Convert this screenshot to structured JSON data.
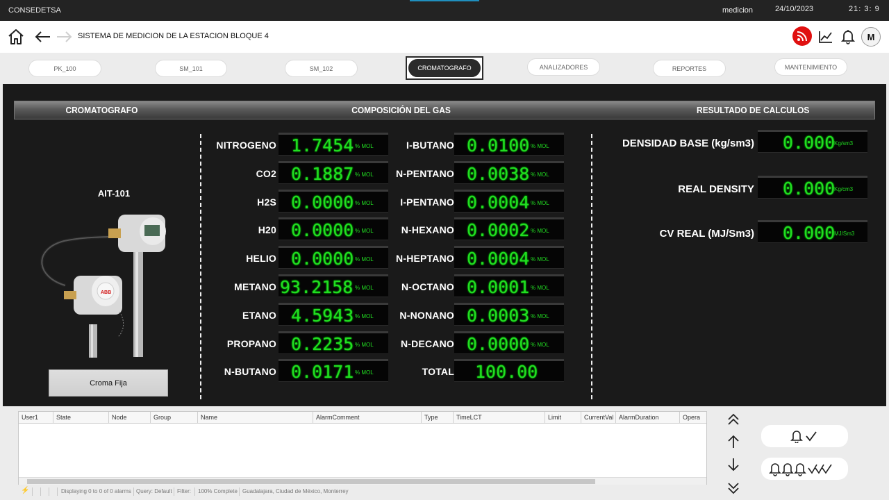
{
  "topbar": {
    "app": "CONSEDETSA",
    "user": "medicion",
    "date": "24/10/2023",
    "time": "21:  3:  9"
  },
  "header": {
    "title": "SISTEMA DE MEDICION DE LA ESTACION BLOQUE 4",
    "avatar": "M"
  },
  "tabs": [
    "PK_100",
    "SM_101",
    "SM_102",
    "CROMATOGRAFO",
    "ANALIZADORES",
    "REPORTES",
    "MANTENIMIENTO"
  ],
  "sections": {
    "left": "CROMATOGRAFO",
    "center": "COMPOSICIÓN DEL GAS",
    "right": "RESULTADO DE CALCULOS"
  },
  "device": {
    "tag": "AIT-101",
    "button": "Croma Fija",
    "brand": "ABB"
  },
  "unit_mol": "% MOL",
  "composition_left": [
    {
      "name": "NITROGENO",
      "value": "1.7454"
    },
    {
      "name": "CO2",
      "value": "0.1887"
    },
    {
      "name": "H2S",
      "value": "0.0000"
    },
    {
      "name": "H20",
      "value": "0.0000"
    },
    {
      "name": "HELIO",
      "value": "0.0000"
    },
    {
      "name": "METANO",
      "value": "93.2158"
    },
    {
      "name": "ETANO",
      "value": "4.5943"
    },
    {
      "name": "PROPANO",
      "value": "0.2235"
    },
    {
      "name": "N-BUTANO",
      "value": "0.0171"
    }
  ],
  "composition_right": [
    {
      "name": "I-BUTANO",
      "value": "0.0100"
    },
    {
      "name": "N-PENTANO",
      "value": "0.0038"
    },
    {
      "name": "I-PENTANO",
      "value": "0.0004"
    },
    {
      "name": "N-HEXANO",
      "value": "0.0002"
    },
    {
      "name": "N-HEPTANO",
      "value": "0.0004"
    },
    {
      "name": "N-OCTANO",
      "value": "0.0001"
    },
    {
      "name": "N-NONANO",
      "value": "0.0003"
    },
    {
      "name": "N-DECANO",
      "value": "0.0000"
    },
    {
      "name": "TOTAL",
      "value": "100.00"
    }
  ],
  "results": [
    {
      "name": "DENSIDAD BASE (kg/sm3)",
      "value": "0.000",
      "unit": "Kg/sm3"
    },
    {
      "name": "REAL DENSITY",
      "value": "0.000",
      "unit": "Kg/cm3"
    },
    {
      "name": "CV REAL (MJ/Sm3)",
      "value": "0.000",
      "unit": "MJ/Sm3"
    }
  ],
  "alarm_columns": [
    "User1",
    "State",
    "Node",
    "Group",
    "Name",
    "AlarmComment",
    "Type",
    "TimeLCT",
    "Limit",
    "CurrentVal",
    "AlarmDuration",
    "Opera"
  ],
  "status": {
    "displaying": "Displaying 0 to 0 of 0 alarms",
    "query": "Query: Default",
    "filter": "Filter:",
    "complete": "100% Complete",
    "location": "Guadalajara, Ciudad de México, Monterrey"
  },
  "colors": {
    "digit": "#22dd22",
    "rss": "#e01010",
    "panel": "#1a1a1a"
  }
}
